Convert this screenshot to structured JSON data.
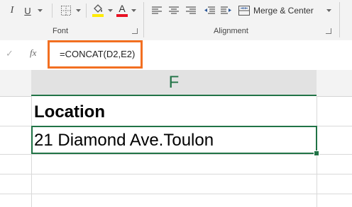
{
  "ribbon": {
    "font_group": {
      "label": "Font",
      "italic": "I",
      "underline": "U",
      "font_color_letter": "A",
      "font_color": "#e81123",
      "fill_color": "#ffeb00"
    },
    "alignment_group": {
      "label": "Alignment",
      "merge_center": "Merge & Center"
    }
  },
  "formula_bar": {
    "cancel_icon": "✓",
    "fx": "fx",
    "formula": "=CONCAT(D2,E2)",
    "highlight_color": "#f26f21"
  },
  "sheet": {
    "column": "F",
    "cells": [
      {
        "value": "Location"
      },
      {
        "value": "21 Diamond Ave.Toulon"
      }
    ],
    "accent": "#217346"
  }
}
